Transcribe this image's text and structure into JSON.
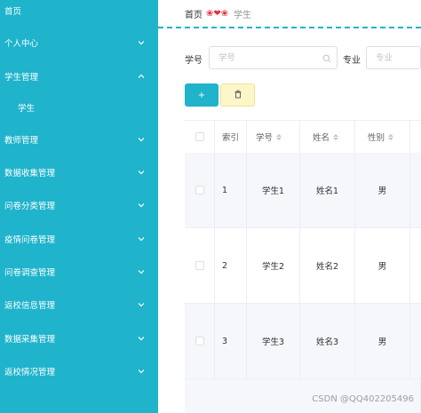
{
  "sidebar": {
    "items": [
      {
        "label": "首页",
        "has_chevron": false
      },
      {
        "label": "个人中心",
        "chevron": "down"
      },
      {
        "label": "学生管理",
        "chevron": "up"
      },
      {
        "label": "学生",
        "sub": true
      },
      {
        "label": "教师管理",
        "chevron": "down"
      },
      {
        "label": "数据收集管理",
        "chevron": "down"
      },
      {
        "label": "问卷分类管理",
        "chevron": "down"
      },
      {
        "label": "疫情问卷管理",
        "chevron": "down"
      },
      {
        "label": "问卷调查管理",
        "chevron": "down"
      },
      {
        "label": "返校信息管理",
        "chevron": "down"
      },
      {
        "label": "数据采集管理",
        "chevron": "down"
      },
      {
        "label": "返校情况管理",
        "chevron": "down"
      }
    ],
    "bg_color": "#1fb3cc"
  },
  "breadcrumb": {
    "home": "首页",
    "decoration": "❤",
    "current": "学生"
  },
  "search": {
    "student_id_label": "学号",
    "student_id_placeholder": "学号",
    "major_label": "专业",
    "major_placeholder": "专业"
  },
  "toolbar": {
    "add_label": "+",
    "delete_icon": "trash-icon"
  },
  "table": {
    "headers": [
      "",
      "索引",
      "学号",
      "姓名",
      "性别"
    ],
    "rows": [
      {
        "index": "1",
        "student_id": "学生1",
        "name": "姓名1",
        "gender": "男"
      },
      {
        "index": "2",
        "student_id": "学生2",
        "name": "姓名2",
        "gender": "男"
      },
      {
        "index": "3",
        "student_id": "学生3",
        "name": "姓名3",
        "gender": "男"
      }
    ]
  },
  "watermark": "CSDN @QQ402205496",
  "colors": {
    "accent": "#1fb3cc",
    "delete_button": "#fdf6c8"
  }
}
